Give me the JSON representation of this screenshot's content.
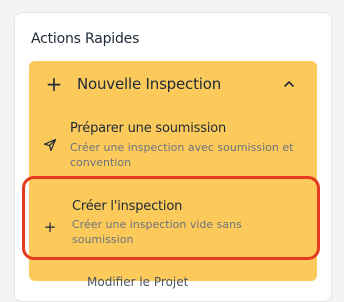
{
  "panel": {
    "title": "Actions Rapides"
  },
  "accordion": {
    "title": "Nouvelle Inspection",
    "expanded": true,
    "icon": "plus-icon",
    "toggle_icon": "chevron-up-icon",
    "color": "#fcca5a",
    "items": [
      {
        "title": "Préparer une soumission",
        "description": "Créer une inspection avec soumission et convention",
        "icon": "send-icon"
      },
      {
        "title": "Créer l'inspection",
        "description": "Créer une inspection vide sans soumission",
        "icon": "plus-icon",
        "highlighted": true
      }
    ]
  },
  "highlight_color": "#e63a20",
  "peek_text": "Modifier le Projet"
}
